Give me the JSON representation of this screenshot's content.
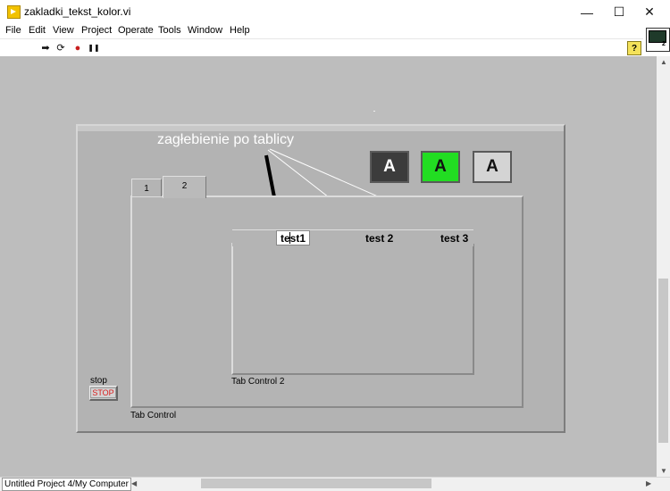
{
  "window": {
    "title": "zakladki_tekst_kolor.vi",
    "minimize": "—",
    "maximize": "☐",
    "close": "✕"
  },
  "menu": [
    "File",
    "Edit",
    "View",
    "Project",
    "Operate",
    "Tools",
    "Window",
    "Help"
  ],
  "toolbar": {
    "run": "➡",
    "run_continuous": "⟳",
    "abort": "●",
    "pause": "❚❚",
    "help": "?"
  },
  "vi_icon": {
    "number": "2"
  },
  "annotation": "zagłebienie po tablicy",
  "boolean_buttons": [
    {
      "label": "A",
      "bg": "#3c3c3c",
      "fg": "#ffffff"
    },
    {
      "label": "A",
      "bg": "#22dd22",
      "fg": "#111111"
    },
    {
      "label": "A",
      "bg": "#d4d4d4",
      "fg": "#111111"
    }
  ],
  "tab_control": {
    "label": "Tab Control",
    "tabs": [
      "1",
      "2"
    ],
    "selected": "2"
  },
  "tab_control_2": {
    "label": "Tab Control 2",
    "tabs": [
      "test1",
      "test 2",
      "test 3"
    ],
    "selected": "test1"
  },
  "stop": {
    "label": "stop",
    "button_text": "STOP"
  },
  "status": {
    "text": "Untitled Project 4/My Computer"
  },
  "scroll": {
    "left": "◀",
    "right": "▶",
    "up": "▲",
    "down": "▼"
  }
}
